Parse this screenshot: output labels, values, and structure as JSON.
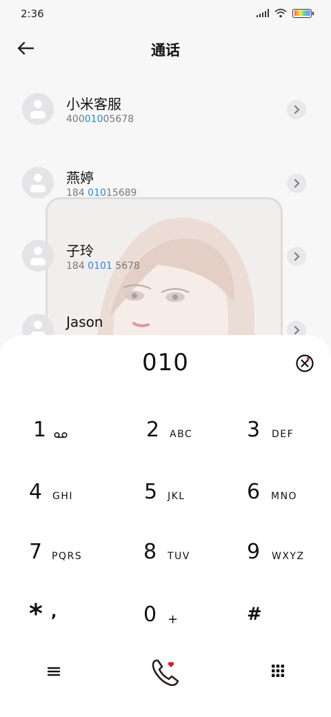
{
  "status_bar": {
    "time": "2:36"
  },
  "header": {
    "title": "通话"
  },
  "contacts": [
    {
      "name": "小米客服",
      "number_pre": "400",
      "number_hl": "010",
      "number_post": "05678"
    },
    {
      "name": "燕婷",
      "number_pre": "184 ",
      "number_hl": "010",
      "number_post": "15689"
    },
    {
      "name": "子玲",
      "number_pre": "184 ",
      "number_hl": "0101",
      "number_post": " 5678"
    },
    {
      "name": "Jason",
      "number_pre": "",
      "number_hl": "",
      "number_post": ""
    }
  ],
  "dialpad": {
    "dialed": "010",
    "keys": [
      {
        "digit": "1",
        "letters": ""
      },
      {
        "digit": "2",
        "letters": "ABC"
      },
      {
        "digit": "3",
        "letters": "DEF"
      },
      {
        "digit": "4",
        "letters": "GHI"
      },
      {
        "digit": "5",
        "letters": "JKL"
      },
      {
        "digit": "6",
        "letters": "MNO"
      },
      {
        "digit": "7",
        "letters": "PQRS"
      },
      {
        "digit": "8",
        "letters": "TUV"
      },
      {
        "digit": "9",
        "letters": "WXYZ"
      },
      {
        "digit": "*",
        "letters": ","
      },
      {
        "digit": "0",
        "letters": "+"
      },
      {
        "digit": "#",
        "letters": ""
      }
    ]
  },
  "icons": {
    "back": "back-arrow-icon",
    "chevron": "chevron-right-icon",
    "voicemail": "voicemail-icon",
    "delete": "delete-icon",
    "menu": "menu-icon",
    "call": "phone-call-icon",
    "keypad": "keypad-icon"
  },
  "colors": {
    "highlight": "#2a86d9",
    "call_accent": "#e2162b"
  }
}
